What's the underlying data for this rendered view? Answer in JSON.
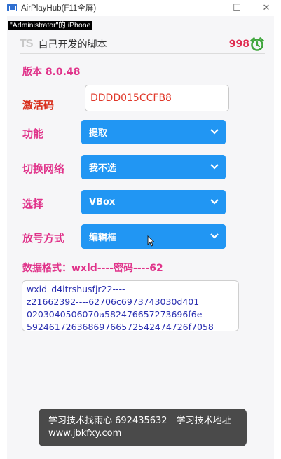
{
  "window": {
    "title": "AirPlayHub(F11全屏)",
    "controls": [
      "—",
      "☐",
      "✕"
    ]
  },
  "device_label": "\"Administrator\"的 iPhone",
  "header": {
    "logo": "TS",
    "title": "自己开发的脚本",
    "counter": "998",
    "alarm_icon": "alarm-clock-icon"
  },
  "version": "版本 8.0.48",
  "activation": {
    "label": "激活码",
    "value": "DDDD015CCFB8"
  },
  "rows": [
    {
      "label": "功能",
      "value": "提取"
    },
    {
      "label": "切换网络",
      "value": "我不选"
    },
    {
      "label": "选择",
      "value": "VBox"
    },
    {
      "label": "放号方式",
      "value": "编辑框"
    }
  ],
  "data_format": "数据格式：wxld----密码----62",
  "data_box_lines": [
    "wxid_d4itrshusfjr22----",
    "z21662392----62706c6973743030d401",
    "0203040506070a582476657273696f6e",
    "59246172636869766572542474726f7058"
  ],
  "toast": "学习技术找雨心 692435632　学习技术地址 www.jbkfxy.com",
  "colors": {
    "accent_blue": "#2196f3",
    "label_pink": "#e0338a",
    "label_red": "#d9321f",
    "counter_red": "#e02d52",
    "alarm_green": "#3fa63c",
    "data_text": "#2a2fb0"
  }
}
